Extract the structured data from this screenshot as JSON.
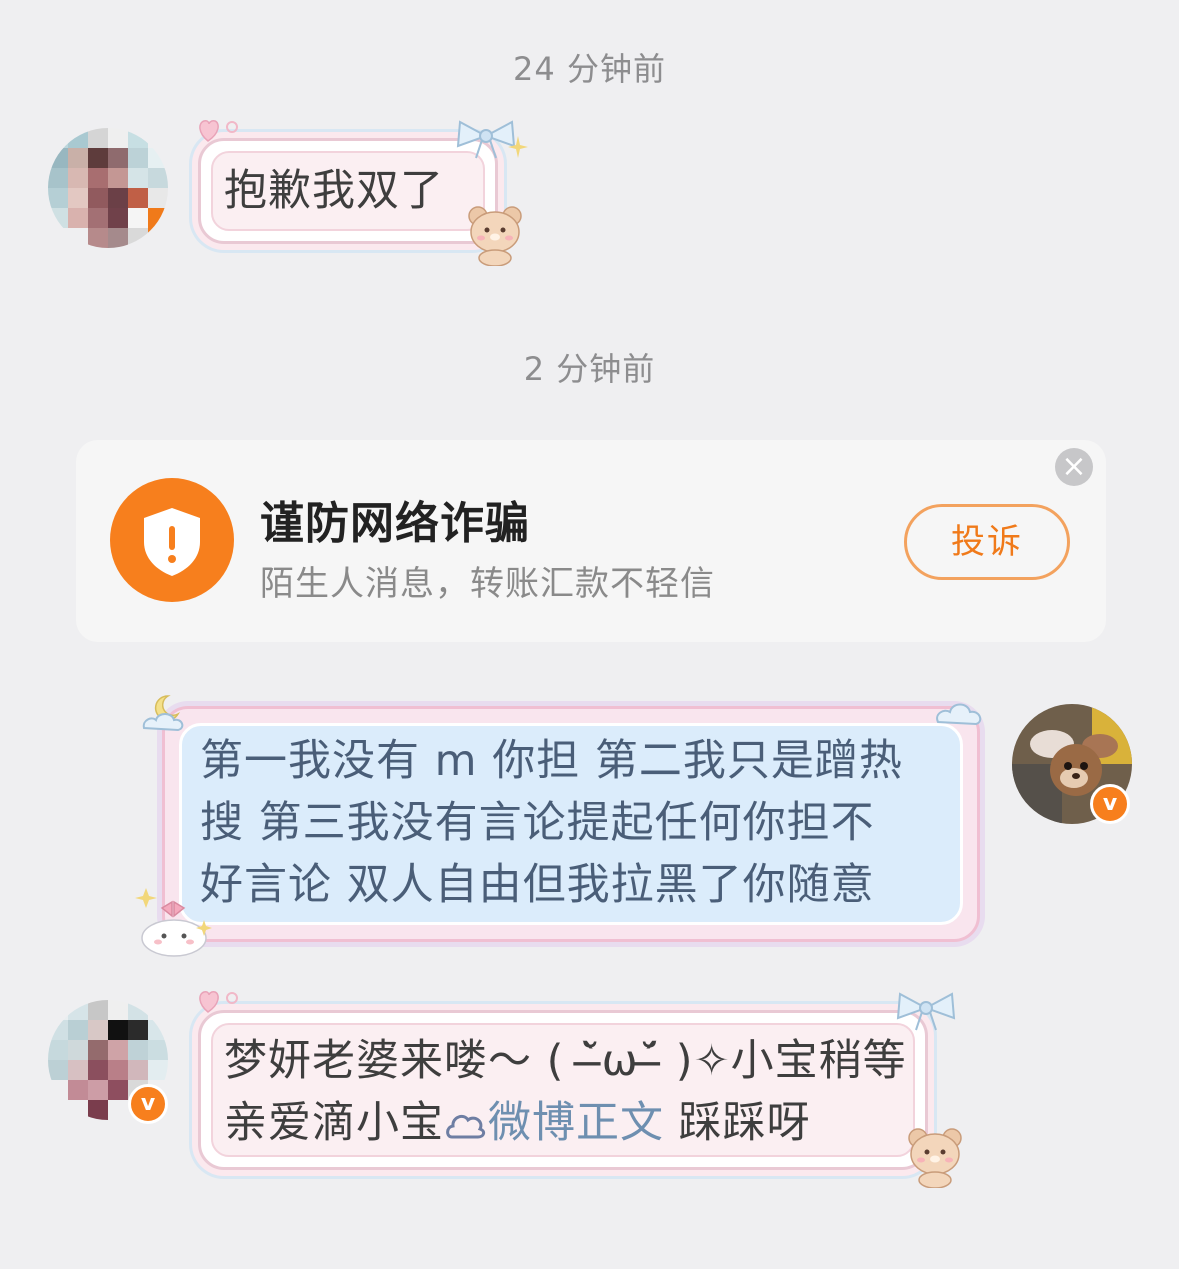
{
  "timestamps": [
    "24 分钟前",
    "2 分钟前"
  ],
  "messages": [
    {
      "side": "left",
      "text": "抱歉我双了",
      "verified": false
    },
    {
      "side": "right",
      "lines": [
        "第一我没有 m 你担 第二我只是蹭热",
        "搜 第三我没有言论提起任何你担不",
        "好言论 双人自由但我拉黑了你随意"
      ],
      "verified": true
    },
    {
      "side": "left",
      "line1": "梦妍老婆来喽～ ( ˘̶̀ω˘̶́ )✧小宝稍等",
      "line2_prefix": "亲爱滴小宝",
      "link_text": "微博正文",
      "line2_suffix": " 踩踩呀",
      "verified": true
    }
  ],
  "safety_card": {
    "title": "谨防网络诈骗",
    "subtitle": "陌生人消息，转账汇款不轻信",
    "button": "投诉",
    "close_symbol": "×",
    "icon": "shield-alert-icon"
  },
  "badge_letter": "v",
  "colors": {
    "accent": "#f77f1d",
    "background": "#efeff1",
    "link": "#6e8fb0"
  }
}
